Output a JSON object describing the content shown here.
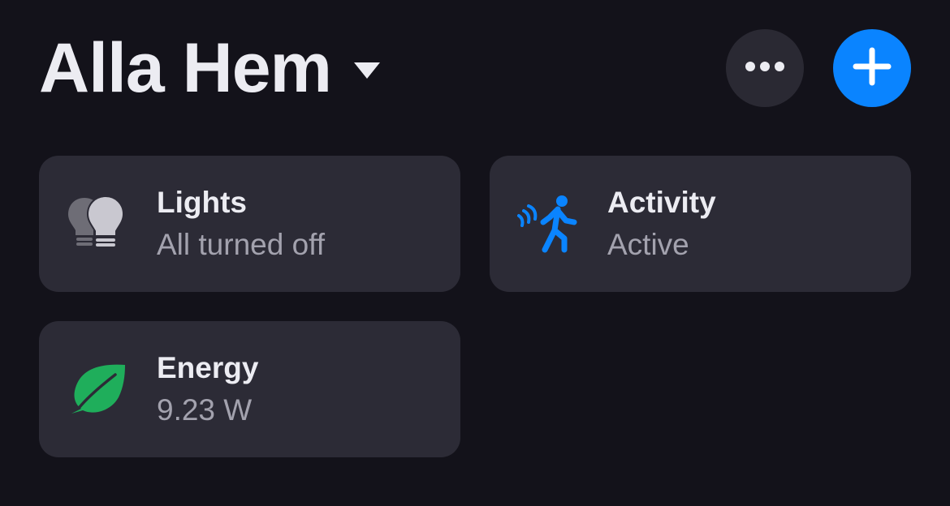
{
  "header": {
    "title": "Alla Hem"
  },
  "tiles": [
    {
      "label": "Lights",
      "status": "All turned off",
      "icon": "lightbulbs-icon"
    },
    {
      "label": "Activity",
      "status": "Active",
      "icon": "motion-sensor-icon"
    },
    {
      "label": "Energy",
      "status": "9.23 W",
      "icon": "leaf-icon"
    }
  ],
  "colors": {
    "background": "#13121a",
    "tile": "#2c2b36",
    "accent": "#0a84ff",
    "energy_green": "#1fae5b",
    "bulb_gray": "#9a99a3"
  }
}
